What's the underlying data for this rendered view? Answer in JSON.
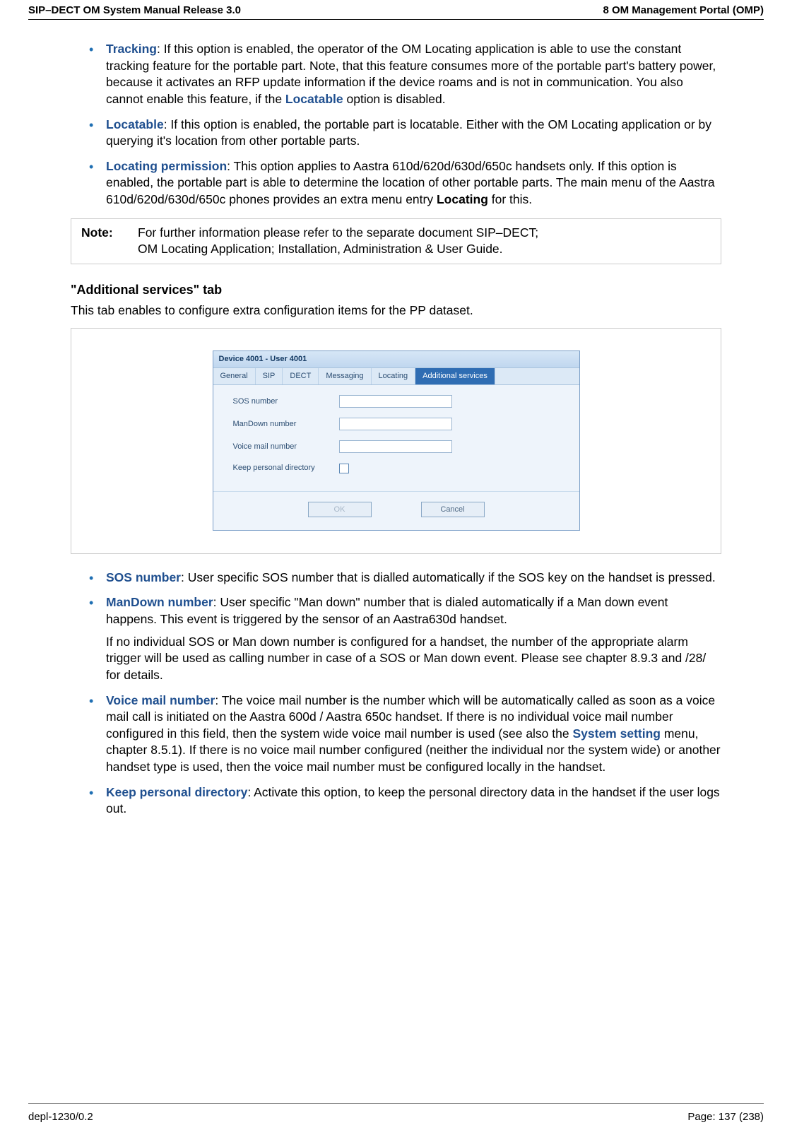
{
  "header": {
    "left": "SIP–DECT OM System Manual Release 3.0",
    "right": "8 OM Management Portal (OMP)"
  },
  "bullets_top": [
    {
      "term": "Tracking",
      "text": ": If this option is enabled, the operator of the OM Locating application is able to use the constant tracking feature for the portable part. Note, that this feature consumes more of the portable part's battery power, because it activates an RFP update information if the device roams and is not in communication. You also cannot enable this feature, if the ",
      "extra_term": "Locatable",
      "extra_tail": " option is disabled."
    },
    {
      "term": "Locatable",
      "text": ": If this option is enabled, the portable part is locatable. Either with the OM Locating application or by querying it's location from other portable parts."
    },
    {
      "term": "Locating permission",
      "text": ": This option applies to Aastra 610d/620d/630d/650c handsets only. If this option is enabled, the portable part is able to determine the location of other portable parts. The main menu of the Aastra 610d/620d/630d/650c phones provides an extra menu entry ",
      "bold_tail": "Locating",
      "tail_after_bold": " for this."
    }
  ],
  "note": {
    "label": "Note:",
    "line1": "For further information please refer to the separate document SIP–DECT;",
    "line2": "OM Locating Application; Installation, Administration & User Guide."
  },
  "section": {
    "heading": "\"Additional services\" tab",
    "intro": "This tab enables to configure extra configuration items for the PP dataset."
  },
  "dialog": {
    "title": "Device 4001 - User 4001",
    "tabs": [
      "General",
      "SIP",
      "DECT",
      "Messaging",
      "Locating",
      "Additional services"
    ],
    "active_tab_index": 5,
    "fields": {
      "sos": "SOS number",
      "mandown": "ManDown number",
      "voicemail": "Voice mail number",
      "keepdir": "Keep personal directory"
    },
    "buttons": {
      "ok": "OK",
      "cancel": "Cancel"
    }
  },
  "bullets_bottom": [
    {
      "term": "SOS number",
      "text": ": User specific SOS number that is dialled automatically if the SOS key on the handset is pressed."
    },
    {
      "term": "ManDown number",
      "text": ": User specific \"Man down\" number that is dialed automatically if a Man down event happens. This event is triggered by the sensor of an Aastra630d handset.",
      "sub": "If no individual SOS or Man down number is configured for a handset, the number of the appropriate alarm trigger will be used as calling number in case of a SOS or Man down event. Please see chapter 8.9.3 and /28/ for details."
    },
    {
      "term": "Voice mail number",
      "text_pre": ": The voice mail number is the number which will be automatically called as soon as a voice mail call is initiated on the Aastra 600d / Aastra 650c handset. If there is no individual voice mail number configured in this field, then the system wide voice mail number is used (see also the ",
      "link": "System setting",
      "text_post": " menu, chapter 8.5.1). If there is no voice mail number configured (neither the individual nor the system wide) or another handset type is used, then the voice mail number must be configured locally in the handset."
    },
    {
      "term": "Keep personal directory",
      "text": ": Activate this option, to keep the personal directory data in the handset if the user logs out."
    }
  ],
  "footer": {
    "left": "depl-1230/0.2",
    "right": "Page: 137 (238)"
  }
}
